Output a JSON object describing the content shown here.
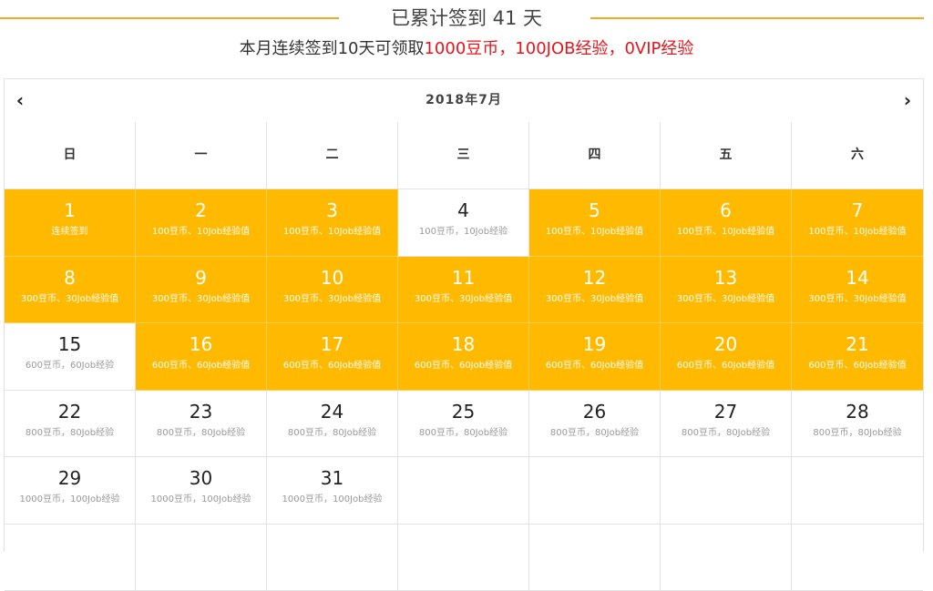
{
  "header": {
    "total": "已累计签到 41 天",
    "sub_prefix": "本月连续签到10天可领取",
    "reward_coins": "1000豆币",
    "sep1": "，",
    "reward_job": "100JOB经验",
    "sep2": "，",
    "reward_vip": "0VIP经验"
  },
  "calendar": {
    "month": "2018年7月",
    "prev": "‹",
    "next": "›",
    "weekdays": [
      "日",
      "一",
      "二",
      "三",
      "四",
      "五",
      "六"
    ],
    "weeks": [
      [
        {
          "day": "1",
          "reward": "连续签到",
          "signed": true
        },
        {
          "day": "2",
          "reward": "100豆币、10Job经验值",
          "signed": true
        },
        {
          "day": "3",
          "reward": "100豆币、10Job经验值",
          "signed": true
        },
        {
          "day": "4",
          "reward": "100豆币，10Job经验",
          "signed": false
        },
        {
          "day": "5",
          "reward": "100豆币、10Job经验值",
          "signed": true
        },
        {
          "day": "6",
          "reward": "100豆币、10Job经验值",
          "signed": true
        },
        {
          "day": "7",
          "reward": "100豆币、10Job经验值",
          "signed": true
        }
      ],
      [
        {
          "day": "8",
          "reward": "300豆币、30Job经验值",
          "signed": true
        },
        {
          "day": "9",
          "reward": "300豆币、30Job经验值",
          "signed": true
        },
        {
          "day": "10",
          "reward": "300豆币、30Job经验值",
          "signed": true
        },
        {
          "day": "11",
          "reward": "300豆币、30Job经验值",
          "signed": true
        },
        {
          "day": "12",
          "reward": "300豆币、30Job经验值",
          "signed": true
        },
        {
          "day": "13",
          "reward": "300豆币、30Job经验值",
          "signed": true
        },
        {
          "day": "14",
          "reward": "300豆币、30Job经验值",
          "signed": true
        }
      ],
      [
        {
          "day": "15",
          "reward": "600豆币，60Job经验",
          "signed": false
        },
        {
          "day": "16",
          "reward": "600豆币、60Job经验值",
          "signed": true
        },
        {
          "day": "17",
          "reward": "600豆币、60Job经验值",
          "signed": true
        },
        {
          "day": "18",
          "reward": "600豆币、60Job经验值",
          "signed": true
        },
        {
          "day": "19",
          "reward": "600豆币、60Job经验值",
          "signed": true
        },
        {
          "day": "20",
          "reward": "600豆币、60Job经验值",
          "signed": true
        },
        {
          "day": "21",
          "reward": "600豆币、60Job经验值",
          "signed": true
        }
      ],
      [
        {
          "day": "22",
          "reward": "800豆币，80Job经验",
          "signed": false
        },
        {
          "day": "23",
          "reward": "800豆币，80Job经验",
          "signed": false
        },
        {
          "day": "24",
          "reward": "800豆币，80Job经验",
          "signed": false
        },
        {
          "day": "25",
          "reward": "800豆币，80Job经验",
          "signed": false
        },
        {
          "day": "26",
          "reward": "800豆币，80Job经验",
          "signed": false
        },
        {
          "day": "27",
          "reward": "800豆币，80Job经验",
          "signed": false
        },
        {
          "day": "28",
          "reward": "800豆币，80Job经验",
          "signed": false
        }
      ],
      [
        {
          "day": "29",
          "reward": "1000豆币，100Job经验",
          "signed": false
        },
        {
          "day": "30",
          "reward": "1000豆币，100Job经验",
          "signed": false
        },
        {
          "day": "31",
          "reward": "1000豆币，100Job经验",
          "signed": false
        },
        {
          "day": "",
          "reward": "",
          "signed": false
        },
        {
          "day": "",
          "reward": "",
          "signed": false
        },
        {
          "day": "",
          "reward": "",
          "signed": false
        },
        {
          "day": "",
          "reward": "",
          "signed": false
        }
      ],
      [
        {
          "day": "",
          "reward": "",
          "signed": false
        },
        {
          "day": "",
          "reward": "",
          "signed": false
        },
        {
          "day": "",
          "reward": "",
          "signed": false
        },
        {
          "day": "",
          "reward": "",
          "signed": false
        },
        {
          "day": "",
          "reward": "",
          "signed": false
        },
        {
          "day": "",
          "reward": "",
          "signed": false
        },
        {
          "day": "",
          "reward": "",
          "signed": false
        }
      ]
    ]
  },
  "colors": {
    "signed_bg": "#ffba00",
    "accent_line": "#f5a623",
    "reward_red": "#e8141b"
  }
}
